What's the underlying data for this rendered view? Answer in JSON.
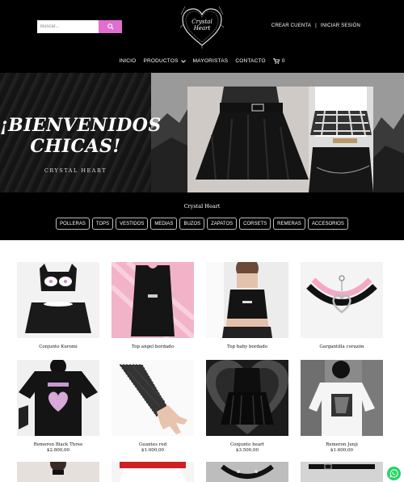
{
  "header": {
    "search_placeholder": "Buscar...",
    "logo_line1": "Crystal",
    "logo_line2": "Heart",
    "create_account": "CREAR CUENTA",
    "separator": "|",
    "login": "INICIAR SESIÓN"
  },
  "nav": {
    "items": [
      "INICIO",
      "PRODUCTOS",
      "MAYORISTAS",
      "CONTACTO"
    ],
    "cart_count": "0"
  },
  "hero": {
    "title_line1": "¡BIENVENIDOS",
    "title_line2": "CHICAS!",
    "subtitle": "CRYSTAL HEART"
  },
  "band": {
    "title": "Crystal Heart",
    "categories": [
      "POLLERAS",
      "TOPS",
      "VESTIDOS",
      "MEDIAS",
      "BUZOS",
      "ZAPATOS",
      "CORSETS",
      "REMERAS",
      "ACCESORIOS"
    ]
  },
  "products": [
    {
      "name": "Conjunto Kuromi",
      "price": ""
    },
    {
      "name": "Top angel bordado",
      "price": ""
    },
    {
      "name": "Top baby bordado",
      "price": ""
    },
    {
      "name": "Gargantilla corazón",
      "price": ""
    },
    {
      "name": "Remeron Black Three",
      "price": "$2.800,00"
    },
    {
      "name": "Guantes red",
      "price": "$1.000,00"
    },
    {
      "name": "Conjunto heart",
      "price": "$3.500,00"
    },
    {
      "name": "Remeron Junji",
      "price": "$1.600,00"
    }
  ],
  "colors": {
    "accent": "#e06fd0",
    "background_dark": "#000000",
    "whatsapp": "#25d366"
  }
}
